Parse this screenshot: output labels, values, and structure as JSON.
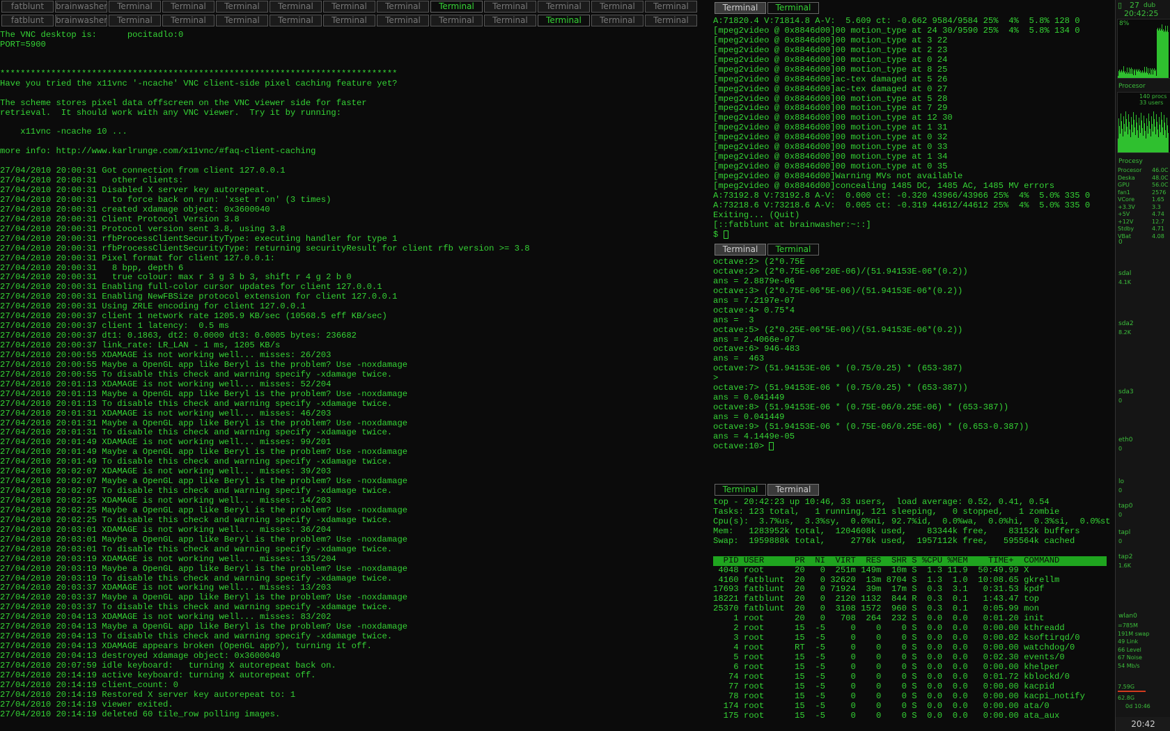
{
  "left_pane": {
    "tabs_row1": [
      "fatblunt",
      "brainwasher",
      "Terminal",
      "Terminal",
      "Terminal",
      "Terminal",
      "Terminal",
      "Terminal",
      "Terminal",
      "Terminal",
      "Terminal",
      "Terminal",
      "Terminal"
    ],
    "tabs_row2": [
      "fatblunt",
      "brainwasher",
      "Terminal",
      "Terminal",
      "Terminal",
      "Terminal",
      "Terminal",
      "Terminal",
      "Terminal",
      "Terminal",
      "Terminal",
      "Terminal",
      "Terminal"
    ],
    "active_tab_row1": "Terminal",
    "active_tab_row2": "Terminal",
    "lines": [
      "The VNC desktop is:      pocitadlo:0",
      "PORT=5900",
      "",
      "",
      "******************************************************************************",
      "Have you tried the x11vnc '-ncache' VNC client-side pixel caching feature yet?",
      "",
      "The scheme stores pixel data offscreen on the VNC viewer side for faster",
      "retrieval.  It should work with any VNC viewer.  Try it by running:",
      "",
      "    x11vnc -ncache 10 ...",
      "",
      "more info: http://www.karlrunge.com/x11vnc/#faq-client-caching",
      "",
      "27/04/2010 20:00:31 Got connection from client 127.0.0.1",
      "27/04/2010 20:00:31   other clients:",
      "27/04/2010 20:00:31 Disabled X server key autorepeat.",
      "27/04/2010 20:00:31   to force back on run: 'xset r on' (3 times)",
      "27/04/2010 20:00:31 created xdamage object: 0x3600040",
      "27/04/2010 20:00:31 Client Protocol Version 3.8",
      "27/04/2010 20:00:31 Protocol version sent 3.8, using 3.8",
      "27/04/2010 20:00:31 rfbProcessClientSecurityType: executing handler for type 1",
      "27/04/2010 20:00:31 rfbProcessClientSecurityType: returning securityResult for client rfb version >= 3.8",
      "27/04/2010 20:00:31 Pixel format for client 127.0.0.1:",
      "27/04/2010 20:00:31   8 bpp, depth 6",
      "27/04/2010 20:00:31   true colour: max r 3 g 3 b 3, shift r 4 g 2 b 0",
      "27/04/2010 20:00:31 Enabling full-color cursor updates for client 127.0.0.1",
      "27/04/2010 20:00:31 Enabling NewFBSize protocol extension for client 127.0.0.1",
      "27/04/2010 20:00:31 Using ZRLE encoding for client 127.0.0.1",
      "27/04/2010 20:00:37 client 1 network rate 1205.9 KB/sec (10568.5 eff KB/sec)",
      "27/04/2010 20:00:37 client 1 latency:  0.5 ms",
      "27/04/2010 20:00:37 dt1: 0.1863, dt2: 0.0000 dt3: 0.0005 bytes: 236682",
      "27/04/2010 20:00:37 link_rate: LR_LAN - 1 ms, 1205 KB/s",
      "27/04/2010 20:00:55 XDAMAGE is not working well... misses: 26/203",
      "27/04/2010 20:00:55 Maybe a OpenGL app like Beryl is the problem? Use -noxdamage",
      "27/04/2010 20:00:55 To disable this check and warning specify -xdamage twice.",
      "27/04/2010 20:01:13 XDAMAGE is not working well... misses: 52/204",
      "27/04/2010 20:01:13 Maybe a OpenGL app like Beryl is the problem? Use -noxdamage",
      "27/04/2010 20:01:13 To disable this check and warning specify -xdamage twice.",
      "27/04/2010 20:01:31 XDAMAGE is not working well... misses: 46/203",
      "27/04/2010 20:01:31 Maybe a OpenGL app like Beryl is the problem? Use -noxdamage",
      "27/04/2010 20:01:31 To disable this check and warning specify -xdamage twice.",
      "27/04/2010 20:01:49 XDAMAGE is not working well... misses: 99/201",
      "27/04/2010 20:01:49 Maybe a OpenGL app like Beryl is the problem? Use -noxdamage",
      "27/04/2010 20:01:49 To disable this check and warning specify -xdamage twice.",
      "27/04/2010 20:02:07 XDAMAGE is not working well... misses: 39/203",
      "27/04/2010 20:02:07 Maybe a OpenGL app like Beryl is the problem? Use -noxdamage",
      "27/04/2010 20:02:07 To disable this check and warning specify -xdamage twice.",
      "27/04/2010 20:02:25 XDAMAGE is not working well... misses: 14/203",
      "27/04/2010 20:02:25 Maybe a OpenGL app like Beryl is the problem? Use -noxdamage",
      "27/04/2010 20:02:25 To disable this check and warning specify -xdamage twice.",
      "27/04/2010 20:03:01 XDAMAGE is not working well... misses: 36/204",
      "27/04/2010 20:03:01 Maybe a OpenGL app like Beryl is the problem? Use -noxdamage",
      "27/04/2010 20:03:01 To disable this check and warning specify -xdamage twice.",
      "27/04/2010 20:03:19 XDAMAGE is not working well... misses: 135/204",
      "27/04/2010 20:03:19 Maybe a OpenGL app like Beryl is the problem? Use -noxdamage",
      "27/04/2010 20:03:19 To disable this check and warning specify -xdamage twice.",
      "27/04/2010 20:03:37 XDAMAGE is not working well... misses: 13/203",
      "27/04/2010 20:03:37 Maybe a OpenGL app like Beryl is the problem? Use -noxdamage",
      "27/04/2010 20:03:37 To disable this check and warning specify -xdamage twice.",
      "27/04/2010 20:04:13 XDAMAGE is not working well... misses: 83/202",
      "27/04/2010 20:04:13 Maybe a OpenGL app like Beryl is the problem? Use -noxdamage",
      "27/04/2010 20:04:13 To disable this check and warning specify -xdamage twice.",
      "27/04/2010 20:04:13 XDAMAGE appears broken (OpenGL app?), turning it off.",
      "27/04/2010 20:04:13 destroyed xdamage object: 0x3600040",
      "27/04/2010 20:07:59 idle keyboard:   turning X autorepeat back on.",
      "27/04/2010 20:14:19 active keyboard: turning X autorepeat off.",
      "27/04/2010 20:14:19 client_count: 0",
      "27/04/2010 20:14:19 Restored X server key autorepeat to: 1",
      "27/04/2010 20:14:19 viewer exited.",
      "27/04/2010 20:14:19 deleted 60 tile_row polling images."
    ]
  },
  "mplayer_pane": {
    "tabs": [
      "Terminal",
      "Terminal"
    ],
    "lines": [
      "A:71820.4 V:71814.8 A-V:  5.609 ct: -0.662 9584/9584 25%  4%  5.8% 128 0",
      "[mpeg2video @ 0x8846d00]00 motion_type at 24 30/9590 25%  4%  5.8% 134 0",
      "[mpeg2video @ 0x8846d00]00 motion_type at 3 22",
      "[mpeg2video @ 0x8846d00]00 motion_type at 2 23",
      "[mpeg2video @ 0x8846d00]00 motion_type at 0 24",
      "[mpeg2video @ 0x8846d00]00 motion_type at 8 25",
      "[mpeg2video @ 0x8846d00]ac-tex damaged at 5 26",
      "[mpeg2video @ 0x8846d00]ac-tex damaged at 0 27",
      "[mpeg2video @ 0x8846d00]00 motion_type at 5 28",
      "[mpeg2video @ 0x8846d00]00 motion_type at 7 29",
      "[mpeg2video @ 0x8846d00]00 motion_type at 12 30",
      "[mpeg2video @ 0x8846d00]00 motion_type at 1 31",
      "[mpeg2video @ 0x8846d00]00 motion_type at 0 32",
      "[mpeg2video @ 0x8846d00]00 motion_type at 0 33",
      "[mpeg2video @ 0x8846d00]00 motion_type at 1 34",
      "[mpeg2video @ 0x8846d00]00 motion_type at 0 35",
      "[mpeg2video @ 0x8846d00]Warning MVs not available",
      "[mpeg2video @ 0x8846d00]concealing 1485 DC, 1485 AC, 1485 MV errors",
      "A:73192.8 V:73192.8 A-V:  0.000 ct: -0.320 43966/43966 25%  4%  5.0% 335 0",
      "A:73218.6 V:73218.6 A-V:  0.005 ct: -0.319 44612/44612 25%  4%  5.0% 335 0",
      "Exiting... (Quit)",
      "[::fatblunt at brainwasher:~::]",
      "$ "
    ]
  },
  "octave_pane": {
    "tabs": [
      "Terminal",
      "Terminal"
    ],
    "lines": [
      "octave:2> (2*0.75E",
      "octave:2> (2*0.75E-06*20E-06)/(51.94153E-06*(0.2))",
      "ans = 2.8879e-06",
      "octave:3> (2*0.75E-06*5E-06)/(51.94153E-06*(0.2))",
      "ans = 7.2197e-07",
      "octave:4> 0.75*4",
      "ans =  3",
      "octave:5> (2*0.25E-06*5E-06)/(51.94153E-06*(0.2))",
      "ans = 2.4066e-07",
      "octave:6> 946-483",
      "ans =  463",
      "octave:7> (51.94153E-06 * (0.75/0.25) * (653-387)",
      ">",
      "octave:7> (51.94153E-06 * (0.75/0.25) * (653-387))",
      "ans = 0.041449",
      "octave:8> (51.94153E-06 * (0.75E-06/0.25E-06) * (653-387))",
      "ans = 0.041449",
      "octave:9> (51.94153E-06 * (0.75E-06/0.25E-06) * (0.653-0.387))",
      "ans = 4.1449e-05",
      "octave:10> "
    ]
  },
  "top_pane": {
    "tabs": [
      "Terminal",
      "Terminal"
    ],
    "summary": [
      "top - 20:42:23 up 10:46, 33 users,  load average: 0.52, 0.41, 0.54",
      "Tasks: 123 total,   1 running, 121 sleeping,   0 stopped,   1 zombie",
      "Cpu(s):  3.7%us,  3.3%sy,  0.0%ni, 92.7%id,  0.0%wa,  0.0%hi,  0.3%si,  0.0%st",
      "Mem:   1283952k total,  1204608k used,    83344k free,    83152k buffers",
      "Swap:  1959888k total,     2776k used,  1957112k free,   595564k cached"
    ],
    "header": "  PID USER      PR  NI  VIRT  RES  SHR S %CPU %MEM    TIME+  COMMAND",
    "rows": [
      " 4048 root      20   0  251m 149m  10m S  1.3 11.9  50:49.99 X",
      " 4160 fatblunt  20   0 32620  13m 8704 S  1.3  1.0  10:08.65 gkrellm",
      "17693 fatblunt  20   0 71924  39m  17m S  0.3  3.1   0:31.53 kpdf",
      "18221 fatblunt  20   0  2120 1132  844 R  0.3  0.1   1:43.47 top",
      "25370 fatblunt  20   0  3108 1572  960 S  0.3  0.1   0:05.99 mon",
      "    1 root      20   0   708  264  232 S  0.0  0.0   0:01.20 init",
      "    2 root      15  -5     0    0    0 S  0.0  0.0   0:00.00 kthreadd",
      "    3 root      15  -5     0    0    0 S  0.0  0.0   0:00.02 ksoftirqd/0",
      "    4 root      RT  -5     0    0    0 S  0.0  0.0   0:00.00 watchdog/0",
      "    5 root      15  -5     0    0    0 S  0.0  0.0   0:02.30 events/0",
      "    6 root      15  -5     0    0    0 S  0.0  0.0   0:00.00 khelper",
      "   74 root      15  -5     0    0    0 S  0.0  0.0   0:01.72 kblockd/0",
      "   77 root      15  -5     0    0    0 S  0.0  0.0   0:00.00 kacpid",
      "   78 root      15  -5     0    0    0 S  0.0  0.0   0:00.00 kacpi_notify",
      "  174 root      15  -5     0    0    0 S  0.0  0.0   0:00.00 ata/0",
      "  175 root      15  -5     0    0    0 S  0.0  0.0   0:00.00 ata_aux"
    ]
  },
  "gkrellm": {
    "date_day": "27",
    "date_month": "dub",
    "time": "20:42:25",
    "cpu_percent": "8%",
    "proc_label": "Procesor",
    "procs": "140 procs",
    "users": "33 users",
    "sensors_title": "Procesy",
    "sensors": [
      {
        "name": "Procesor",
        "value": "46.0C"
      },
      {
        "name": "Deska",
        "value": "48.0C"
      },
      {
        "name": "GPU",
        "value": "56.0C"
      },
      {
        "name": "fan1",
        "value": "2576"
      },
      {
        "name": "VCore",
        "value": "1.65"
      },
      {
        "name": "+3.3V",
        "value": "3.3"
      },
      {
        "name": "+5V",
        "value": "4.74"
      },
      {
        "name": "+12V",
        "value": "12.7"
      },
      {
        "name": "Stdby",
        "value": "4.71"
      },
      {
        "name": "VBat",
        "value": "4.08"
      }
    ],
    "zero": "0",
    "disks": [
      {
        "name": "sdal",
        "value": "4.1K"
      },
      {
        "name": "sda2",
        "value": "8.2K"
      },
      {
        "name": "sda3",
        "value": "0"
      }
    ],
    "nets": [
      {
        "name": "eth0",
        "value": "0"
      },
      {
        "name": "lo",
        "value": "0"
      },
      {
        "name": "tap0",
        "value": "0"
      },
      {
        "name": "tapl",
        "value": "0"
      },
      {
        "name": "tap2",
        "value": "1.6K"
      }
    ],
    "wlan": "wlan0",
    "wlan_details": [
      "=785M",
      "191M swap",
      "49 Link",
      "66 Level",
      "67 Noise",
      "54 Mb/s"
    ],
    "mem_used": "7.59G",
    "disk_free": "62.8G",
    "uptime": "0d 10:46",
    "clock_bottom": "20:42",
    "colors": {
      "fg": "#35d435",
      "bg": "#0b0b0b",
      "panel": "#151515",
      "red": "#d23a1e"
    }
  }
}
